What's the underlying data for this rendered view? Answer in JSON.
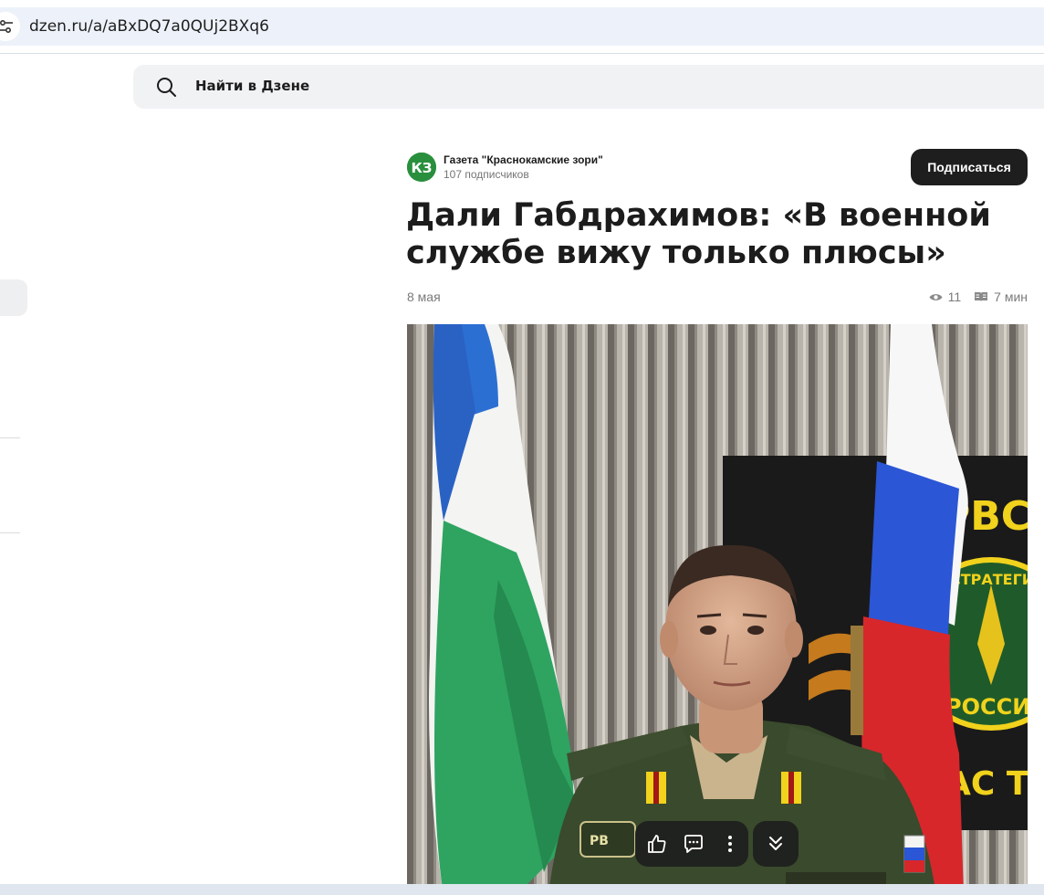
{
  "browser": {
    "url": "dzen.ru/a/aBxDQ7a0QUj2BXq6",
    "site_info_icon": "tune-icon"
  },
  "search": {
    "label": "Найти в Дзене",
    "icon": "search-icon"
  },
  "channel": {
    "name": "Газета \"Краснокамские зори\"",
    "subscribers": "107 подписчиков",
    "logo_text": "КЗ",
    "subscribe_label": "Подписаться"
  },
  "article": {
    "title": "Дали Габдрахимов: «В военной службе вижу только плюсы»",
    "date": "8 мая",
    "views": "11",
    "read_time": "7 мин",
    "image_description": "photo-soldier-with-flags"
  },
  "photo_text": {
    "banner_top": "РВСН",
    "banner_ring": "СТРАТЕГИЧЕ",
    "banner_bottom": "РОССИЯ",
    "banner_lower": "АС Т",
    "patch": "РВ"
  },
  "toolbar": {
    "like": "thumb-up-icon",
    "comment": "comment-icon",
    "more": "more-vertical-icon",
    "scroll": "double-chevron-down-icon"
  },
  "colors": {
    "accent_dark": "#1e1e1e",
    "logo_green": "#2a8f3d"
  }
}
